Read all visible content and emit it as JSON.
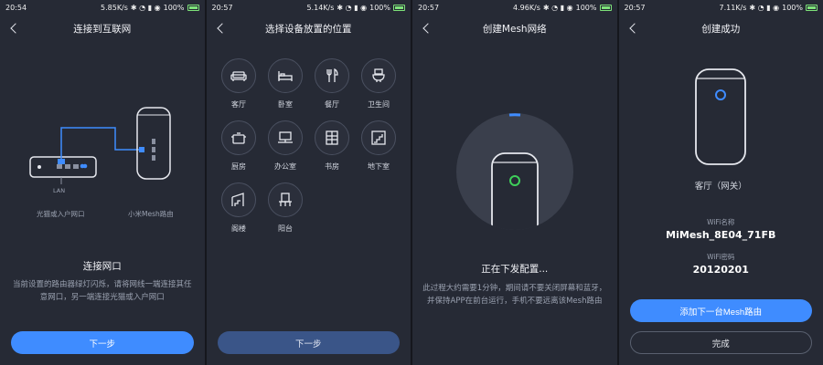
{
  "colors": {
    "bg": "#262a35",
    "accent": "#3f8cff",
    "battery": "#7ee37a",
    "status_green": "#3ecf5a"
  },
  "status_bars": [
    {
      "time": "20:54",
      "speed": "5.85K/s",
      "battery": "100%"
    },
    {
      "time": "20:57",
      "speed": "5.14K/s",
      "battery": "100%"
    },
    {
      "time": "20:57",
      "speed": "4.96K/s",
      "battery": "100%"
    },
    {
      "time": "20:57",
      "speed": "7.11K/s",
      "battery": "100%"
    }
  ],
  "screen1": {
    "title": "连接到互联网",
    "lan_label": "LAN",
    "modem_label": "光猫或入户网口",
    "router_label": "小米Mesh路由",
    "heading": "连接网口",
    "description": "当前设置的路由器绿灯闪烁，请将网线一端连接其任意网口，另一端连接光猫或入户网口",
    "next_button": "下一步"
  },
  "screen2": {
    "title": "选择设备放置的位置",
    "rooms": [
      {
        "label": "客厅",
        "icon": "sofa-icon"
      },
      {
        "label": "卧室",
        "icon": "bed-icon"
      },
      {
        "label": "餐厅",
        "icon": "cutlery-icon"
      },
      {
        "label": "卫生间",
        "icon": "toilet-icon"
      },
      {
        "label": "厨房",
        "icon": "cooking-pot-icon"
      },
      {
        "label": "办公室",
        "icon": "computer-desk-icon"
      },
      {
        "label": "书房",
        "icon": "bookshelf-icon"
      },
      {
        "label": "地下室",
        "icon": "stairs-down-icon"
      },
      {
        "label": "阁楼",
        "icon": "attic-stairs-icon"
      },
      {
        "label": "阳台",
        "icon": "balcony-door-icon"
      }
    ],
    "next_button": "下一步"
  },
  "screen3": {
    "title": "创建Mesh网络",
    "heading": "正在下发配置...",
    "description": "此过程大约需要1分钟，期间请不要关闭屏幕和蓝牙，并保持APP在前台运行，手机不要远离该Mesh路由"
  },
  "screen4": {
    "title": "创建成功",
    "location": "客厅（网关）",
    "wifi_name_label": "WiFi名称",
    "wifi_name": "MiMesh_8E04_71FB",
    "wifi_password_label": "WiFi密码",
    "wifi_password": "20120201",
    "add_button": "添加下一台Mesh路由",
    "done_button": "完成"
  }
}
